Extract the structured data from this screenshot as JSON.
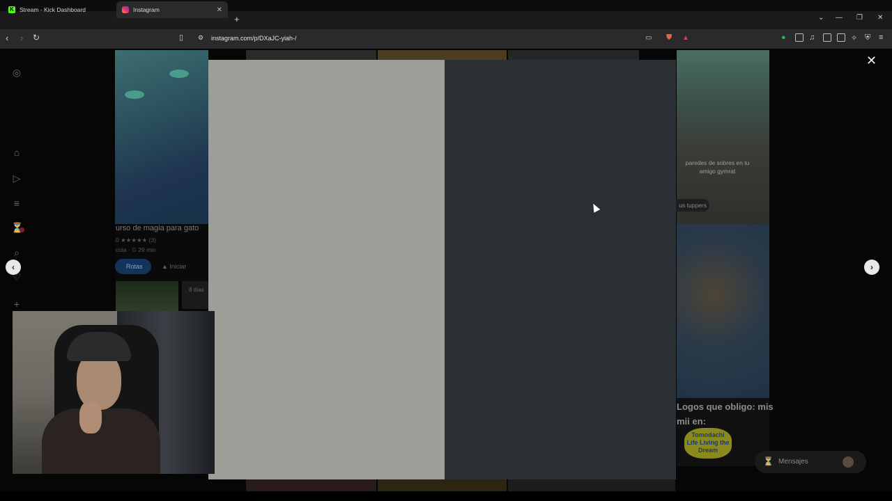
{
  "browser": {
    "tabs": [
      {
        "title": "Stream - Kick Dashboard",
        "active": false
      },
      {
        "title": "Instagram",
        "active": true
      }
    ],
    "url": "instagram.com/p/DXaJC-yiah-/",
    "new_tab": "+",
    "tab_close": "✕",
    "window_controls": [
      "⌄",
      "—",
      "❐",
      "✕"
    ]
  },
  "feed": {
    "course": {
      "title": "urso de magia para gato",
      "rating_text": "0 ★★★★★ (3)",
      "meta": "cola · ⏲ 29 min",
      "rotas_button": "Rotas",
      "iniciar_button": "Iniciar"
    },
    "dias_label": "8 días",
    "gym_caption": "paredes de sobres en tu amigo gymrat",
    "gym_pill": "us tuppers",
    "logos_caption": "Logos que obligo: mis mii en:",
    "tomodachi_text": "Tomodachi Life Living the Dream"
  },
  "messages": {
    "label": "Mensajes"
  },
  "modal": {
    "close": "✕",
    "prev": "‹",
    "next": "›",
    "left_panel_color": "#9e9e99",
    "right_panel_color": "#2b3035"
  },
  "icons": {
    "sidebar": [
      "instagram-icon",
      "home-icon",
      "reels-icon",
      "filter-icon",
      "activity-icon",
      "search-icon",
      "heart-icon",
      "create-icon"
    ]
  }
}
